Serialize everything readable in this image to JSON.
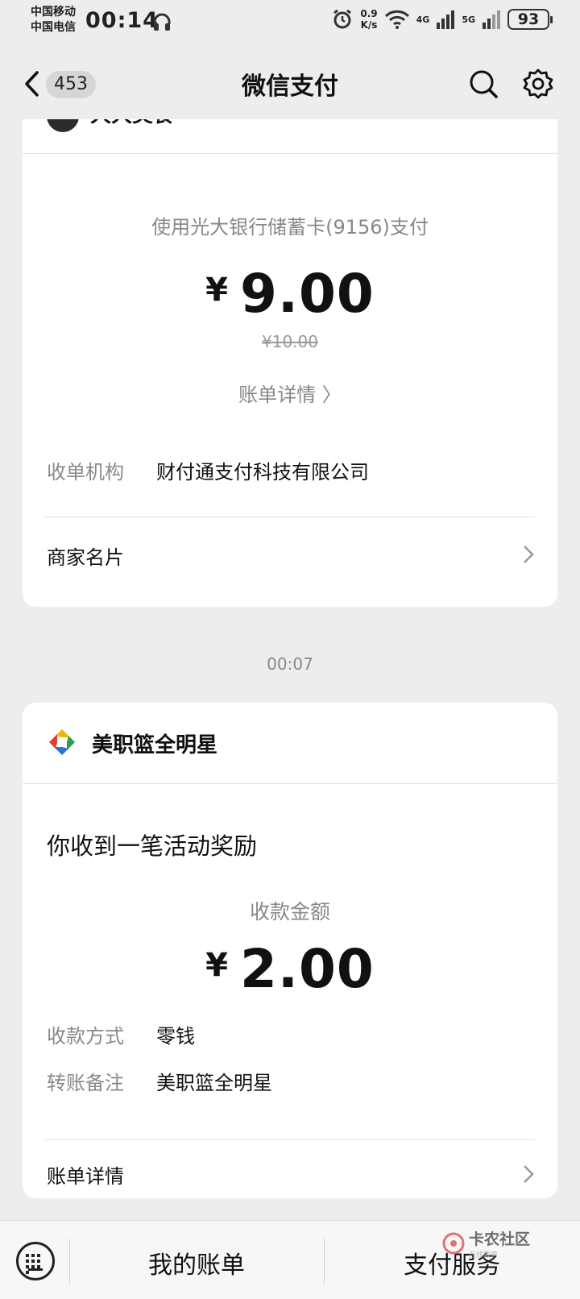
{
  "status_bar": {
    "carrier_1": "中国移动",
    "carrier_2": "中国电信",
    "time": "00:14",
    "speed_value": "0.9",
    "speed_unit": "K/s",
    "net_1": "4G",
    "net_2": "5G",
    "battery": "93"
  },
  "nav": {
    "unread_count": "453",
    "title": "微信支付"
  },
  "card1": {
    "merchant_name_partial": "大大美食",
    "pay_method": "使用光大银行储蓄卡(9156)支付",
    "currency": "¥",
    "amount": "9.00",
    "original_amount": "¥10.00",
    "bill_detail_link": "账单详情 〉",
    "acquirer_label": "收单机构",
    "acquirer_value": "财付通支付科技有限公司",
    "merchant_card_label": "商家名片"
  },
  "timestamp": "00:07",
  "card2": {
    "merchant_name": "美职篮全明星",
    "notice": "你收到一笔活动奖励",
    "received_label": "收款金额",
    "currency": "¥",
    "amount": "2.00",
    "method_label": "收款方式",
    "method_value": "零钱",
    "remark_label": "转账备注",
    "remark_value": "美职篮全明星",
    "bill_detail_label": "账单详情"
  },
  "bottom_bar": {
    "tab_1": "我的账单",
    "tab_2": "支付服务",
    "watermark": "卡农社区",
    "watermark_sub": "在线教育"
  }
}
